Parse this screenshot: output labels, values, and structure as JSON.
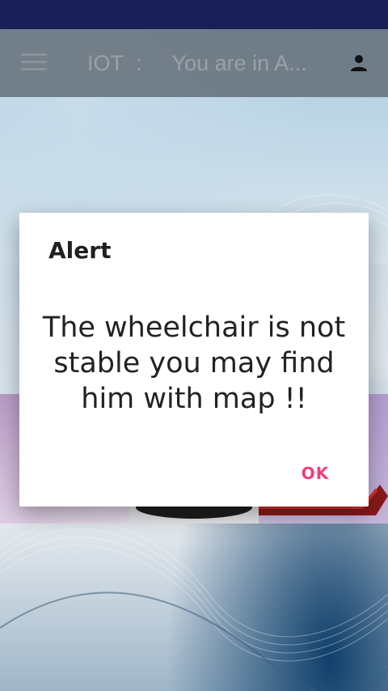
{
  "status_bar": {
    "color": "#1a1f5a"
  },
  "toolbar": {
    "menu_icon": "menu-icon",
    "title_prefix": "IOT",
    "title_separator": ":",
    "title_text": "You are in A...",
    "account_icon": "person-icon"
  },
  "dialog": {
    "title": "Alert",
    "message": "The wheelchair is not stable you may find him with map !!",
    "ok_label": "OK",
    "accent_color": "#ef3f7a"
  }
}
